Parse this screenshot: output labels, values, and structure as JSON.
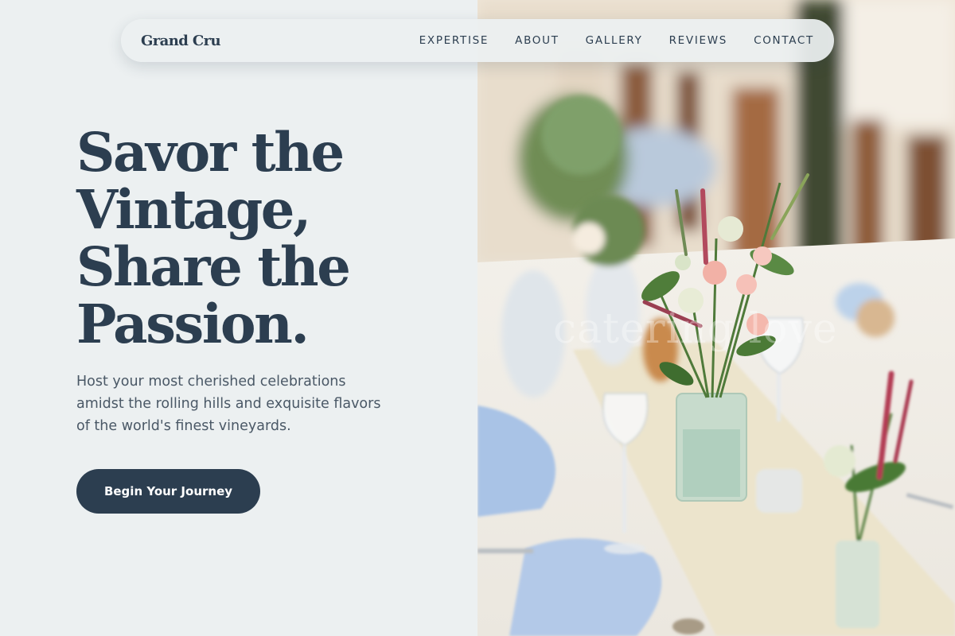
{
  "nav": {
    "brand": "Grand Cru",
    "links": [
      "EXPERTISE",
      "ABOUT",
      "GALLERY",
      "REVIEWS",
      "CONTACT"
    ]
  },
  "hero": {
    "title_lines": [
      "Savor the",
      "Vintage,",
      "Share the",
      "Passion."
    ],
    "subtitle_lines": [
      "Host your most cherished celebrations",
      "amidst the rolling hills and exquisite flavors",
      "of the world's finest vineyards."
    ],
    "cta_label": "Begin Your Journey",
    "image_watermark": "catering love"
  },
  "colors": {
    "primary": "#2c3e50",
    "background": "#ecf0f1",
    "text_muted": "#4a5866",
    "button_text": "#ffffff"
  }
}
